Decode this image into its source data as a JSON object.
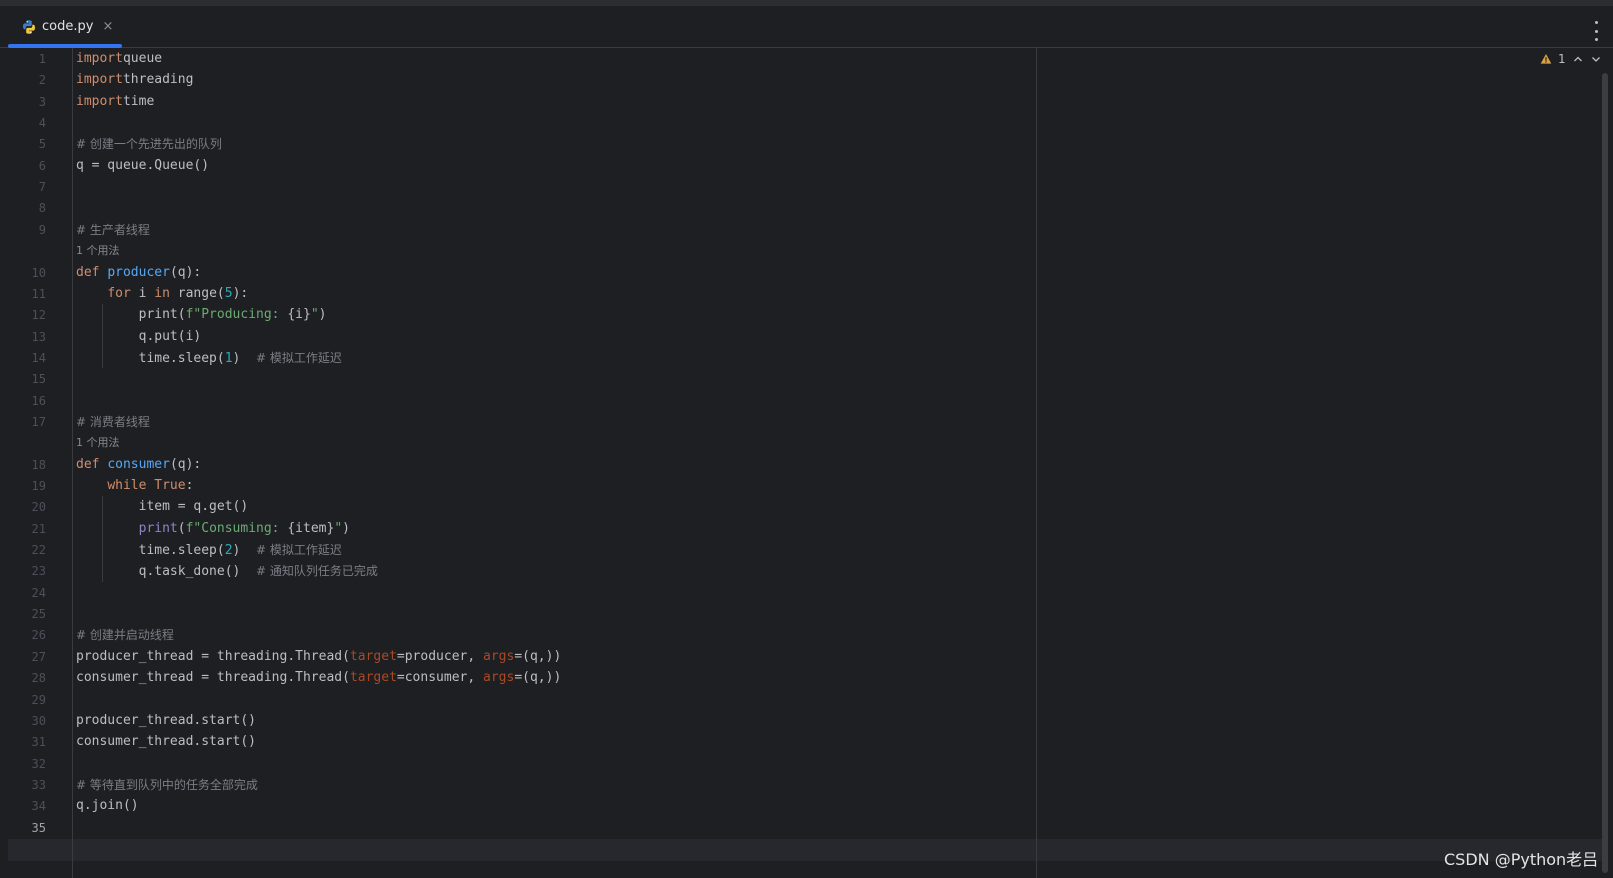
{
  "tab": {
    "filename": "code.py",
    "close_glyph": "×",
    "icon": "python-icon"
  },
  "inspection": {
    "warning_count": "1",
    "icon": "warning-icon"
  },
  "hint_label": "1 个用法",
  "lines": [
    {
      "n": "1",
      "tokens": [
        [
          "kw",
          "import"
        ],
        [
          "",
          "queue"
        ]
      ]
    },
    {
      "n": "2",
      "tokens": [
        [
          "kw",
          "import"
        ],
        [
          "",
          "threading"
        ]
      ]
    },
    {
      "n": "3",
      "tokens": [
        [
          "kw",
          "import"
        ],
        [
          "",
          "time"
        ]
      ]
    },
    {
      "n": "4",
      "tokens": []
    },
    {
      "n": "5",
      "tokens": [
        [
          "cmt",
          "# 创建一个先进先出的队列"
        ]
      ]
    },
    {
      "n": "6",
      "tokens": [
        [
          "",
          "q = queue.Queue()"
        ]
      ]
    },
    {
      "n": "7",
      "tokens": []
    },
    {
      "n": "8",
      "tokens": []
    },
    {
      "n": "9",
      "tokens": [
        [
          "cmt",
          "# 生产者线程"
        ]
      ],
      "hint": true
    },
    {
      "n": "10",
      "tokens": [
        [
          "kw",
          "def "
        ],
        [
          "fn",
          "producer"
        ],
        [
          "",
          "(q):"
        ]
      ]
    },
    {
      "n": "11",
      "tokens": [
        [
          "",
          "    "
        ],
        [
          "kw",
          "for "
        ],
        [
          "",
          "i "
        ],
        [
          "kw",
          "in "
        ],
        [
          "",
          "range("
        ],
        [
          "num",
          "5"
        ],
        [
          "",
          "):"
        ]
      ]
    },
    {
      "n": "12",
      "tokens": [
        [
          "",
          "        print("
        ],
        [
          "str",
          "f\"Producing: "
        ],
        [
          "",
          "{i}"
        ],
        [
          "str",
          "\""
        ],
        [
          "",
          ")"
        ]
      ]
    },
    {
      "n": "13",
      "tokens": [
        [
          "",
          "        q.put(i)"
        ]
      ]
    },
    {
      "n": "14",
      "tokens": [
        [
          "",
          "        time.sleep("
        ],
        [
          "num",
          "1"
        ],
        [
          "",
          ")  "
        ],
        [
          "cmt",
          "# 模拟工作延迟"
        ]
      ]
    },
    {
      "n": "15",
      "tokens": []
    },
    {
      "n": "16",
      "tokens": []
    },
    {
      "n": "17",
      "tokens": [
        [
          "cmt",
          "# 消费者线程"
        ]
      ],
      "hint": true
    },
    {
      "n": "18",
      "tokens": [
        [
          "kw",
          "def "
        ],
        [
          "fn",
          "consumer"
        ],
        [
          "",
          "(q):"
        ]
      ]
    },
    {
      "n": "19",
      "tokens": [
        [
          "",
          "    "
        ],
        [
          "kw",
          "while True"
        ],
        [
          "",
          ":"
        ]
      ]
    },
    {
      "n": "20",
      "tokens": [
        [
          "",
          "        item = q.get()"
        ]
      ]
    },
    {
      "n": "21",
      "tokens": [
        [
          "",
          "        "
        ],
        [
          "bi",
          "print"
        ],
        [
          "",
          "("
        ],
        [
          "str",
          "f\"Consuming: "
        ],
        [
          "",
          "{item}"
        ],
        [
          "str",
          "\""
        ],
        [
          "",
          ")"
        ]
      ]
    },
    {
      "n": "22",
      "tokens": [
        [
          "",
          "        time.sleep("
        ],
        [
          "num",
          "2"
        ],
        [
          "",
          ")  "
        ],
        [
          "cmt",
          "# 模拟工作延迟"
        ]
      ]
    },
    {
      "n": "23",
      "tokens": [
        [
          "",
          "        q.task_done()  "
        ],
        [
          "cmt",
          "# 通知队列任务已完成"
        ]
      ]
    },
    {
      "n": "24",
      "tokens": []
    },
    {
      "n": "25",
      "tokens": []
    },
    {
      "n": "26",
      "tokens": [
        [
          "cmt",
          "# 创建并启动线程"
        ]
      ]
    },
    {
      "n": "27",
      "tokens": [
        [
          "",
          "producer_thread = threading.Thread("
        ],
        [
          "par",
          "target"
        ],
        [
          "",
          "=producer, "
        ],
        [
          "par",
          "args"
        ],
        [
          "",
          "=(q,))"
        ]
      ]
    },
    {
      "n": "28",
      "tokens": [
        [
          "",
          "consumer_thread = threading.Thread("
        ],
        [
          "par",
          "target"
        ],
        [
          "",
          "=consumer, "
        ],
        [
          "par",
          "args"
        ],
        [
          "",
          "=(q,))"
        ]
      ]
    },
    {
      "n": "29",
      "tokens": []
    },
    {
      "n": "30",
      "tokens": [
        [
          "",
          "producer_thread.start()"
        ]
      ]
    },
    {
      "n": "31",
      "tokens": [
        [
          "",
          "consumer_thread.start()"
        ]
      ]
    },
    {
      "n": "32",
      "tokens": []
    },
    {
      "n": "33",
      "tokens": [
        [
          "cmt",
          "# 等待直到队列中的任务全部完成"
        ]
      ]
    },
    {
      "n": "34",
      "tokens": [
        [
          "",
          "q.join()"
        ]
      ]
    },
    {
      "n": "35",
      "tokens": [],
      "current": true
    }
  ],
  "watermark": "CSDN @Python老吕"
}
